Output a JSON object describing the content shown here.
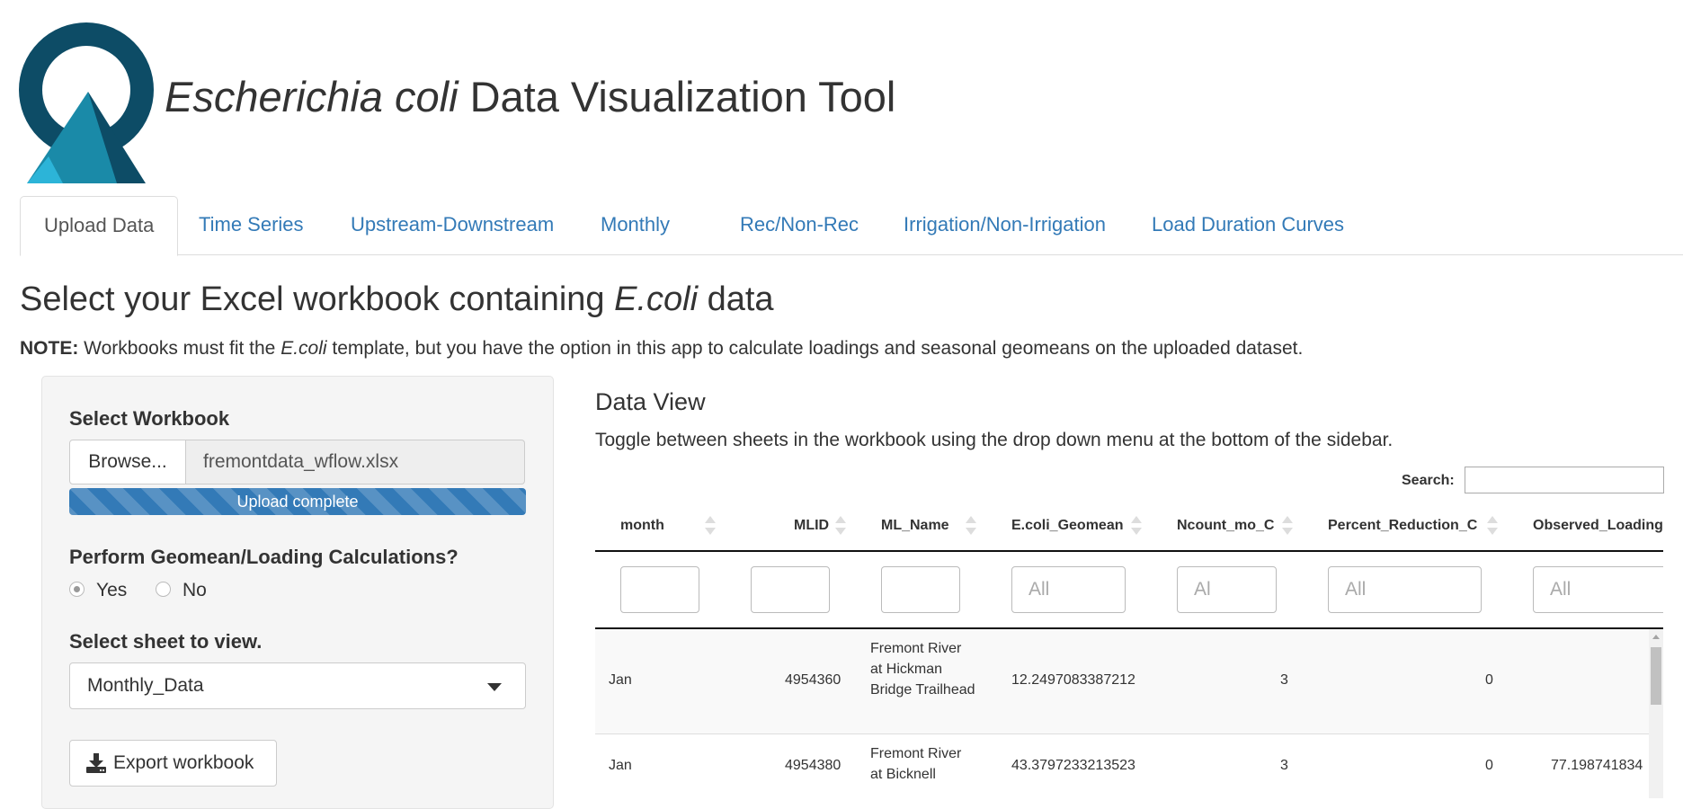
{
  "header": {
    "title_italic": "Escherichia coli",
    "title_rest": " Data Visualization Tool",
    "logo_colors": {
      "dark": "#0d4c66",
      "mid": "#1a8aa8",
      "light": "#2cb4d8"
    }
  },
  "tabs": [
    {
      "label": "Upload Data",
      "active": true
    },
    {
      "label": "Time Series"
    },
    {
      "label": "Upstream-Downstream"
    },
    {
      "label": "Monthly"
    },
    {
      "label": "Rec/Non-Rec"
    },
    {
      "label": "Irrigation/Non-Irrigation"
    },
    {
      "label": "Load Duration Curves"
    }
  ],
  "page": {
    "heading_pre": "Select your Excel workbook containing ",
    "heading_italic": "E.coli",
    "heading_post": " data",
    "note_bold": "NOTE:",
    "note_pre": " Workbooks must fit the ",
    "note_italic": "E.coli",
    "note_post": " template, but you have the option in this app to calculate loadings and seasonal geomeans on the uploaded dataset."
  },
  "sidebar": {
    "workbook_label": "Select Workbook",
    "browse_label": "Browse...",
    "file_name": "fremontdata_wflow.xlsx",
    "upload_status": "Upload complete",
    "upload_progress": 1.0,
    "calc_label": "Perform Geomean/Loading Calculations?",
    "radio_yes": "Yes",
    "radio_no": "No",
    "radio_selected": "Yes",
    "sheet_label": "Select sheet to view.",
    "sheet_value": "Monthly_Data",
    "export_label": "Export workbook"
  },
  "main": {
    "title": "Data View",
    "description": "Toggle between sheets in the workbook using the drop down menu at the bottom of the sidebar.",
    "search_label": "Search:"
  },
  "table": {
    "columns": [
      "month",
      "MLID",
      "ML_Name",
      "E.coli_Geomean",
      "Ncount_mo_C",
      "Percent_Reduction_C",
      "Observed_Loading"
    ],
    "filters": [
      "",
      "",
      "",
      "All",
      "Al",
      "All",
      "All"
    ],
    "rows": [
      {
        "month": "Jan",
        "MLID": "4954360",
        "ML_Name": "Fremont River at Hickman Bridge Trailhead",
        "geomean": "12.2497083387212",
        "ncount": "3",
        "pct": "0",
        "observed": ""
      },
      {
        "month": "Jan",
        "MLID": "4954380",
        "ML_Name": "Fremont River at Bicknell",
        "geomean": "43.3797233213523",
        "ncount": "3",
        "pct": "0",
        "observed": "77.198741834"
      }
    ]
  }
}
